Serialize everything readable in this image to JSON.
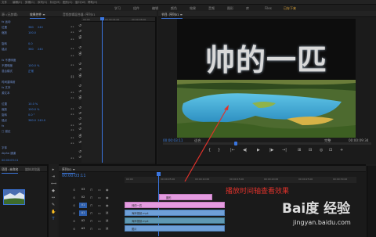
{
  "menubar": {
    "items": [
      "文件",
      "编辑(E)",
      "剪辑(C)",
      "序列(S)",
      "标记(M)",
      "图形(G)",
      "窗口(W)",
      "帮助(H)"
    ]
  },
  "workspace": {
    "items": [
      "学习",
      "组件",
      "编辑",
      "颜色",
      "效果",
      "音频",
      "图形",
      "库",
      "Files",
      "已存下来"
    ]
  },
  "effect_panel": {
    "tabs": [
      "源: (无剪辑)",
      "效果控件 ≡",
      "音频剪辑混合器: 序列01"
    ],
    "rows": [
      {
        "label": "fx 运动",
        "v": "",
        "v2": ""
      },
      {
        "label": "位置",
        "v": "360",
        "v2": "240"
      },
      {
        "label": "缩放",
        "v": "100.0",
        "v2": ""
      },
      {
        "label": "",
        "v": "",
        "v2": ""
      },
      {
        "label": "旋转",
        "v": "0.0",
        "v2": ""
      },
      {
        "label": "锚点",
        "v": "360",
        "v2": "240"
      },
      {
        "label": "",
        "v": "",
        "v2": ""
      },
      {
        "label": "fx 不透明度",
        "v": "",
        "v2": ""
      },
      {
        "label": "不透明度",
        "v": "100.0 %",
        "v2": ""
      },
      {
        "label": "混合模式",
        "v": "正常",
        "v2": ""
      },
      {
        "label": "",
        "v": "",
        "v2": ""
      },
      {
        "label": "时间重映射",
        "v": "",
        "v2": ""
      },
      {
        "label": "fx 文本",
        "v": "",
        "v2": ""
      },
      {
        "label": "源文本",
        "v": "",
        "v2": ""
      },
      {
        "label": "",
        "v": "",
        "v2": ""
      },
      {
        "label": "位置",
        "v": "10.0 %",
        "v2": ""
      },
      {
        "label": "缩放",
        "v": "100.0 %",
        "v2": ""
      },
      {
        "label": "旋转",
        "v": "0.0 °",
        "v2": ""
      },
      {
        "label": "锚点",
        "v": "360.0",
        "v2": "240.0"
      },
      {
        "label": "fx",
        "v": "",
        "v2": ""
      },
      {
        "label": "□ 描边",
        "v": "",
        "v2": ""
      },
      {
        "label": "",
        "v": "",
        "v2": ""
      },
      {
        "label": "",
        "v": "",
        "v2": ""
      },
      {
        "label": "字体",
        "v": "",
        "v2": ""
      },
      {
        "label": "Alpha 通道",
        "v": "",
        "v2": ""
      }
    ],
    "ruler_ticks": [
      "00:00",
      "00:00:04:00",
      "00:00:08:00"
    ],
    "bottom_timecode": "00:00:03:11"
  },
  "program": {
    "tab_label": "节目: 序列01 ≡",
    "title_text": "帅的一匹",
    "current_timecode": "00:00:03:11",
    "fit_label": "适合",
    "quality_label": "完整",
    "duration_timecode": "00:00:09:34",
    "transport_buttons": [
      "{",
      "}",
      "|←",
      "◀|",
      "▶",
      "|▶",
      "→|",
      "⊞",
      "⊟",
      "◎",
      "⊡",
      "+"
    ]
  },
  "project": {
    "tabs": [
      "项目: 未命名",
      "媒体浏览器"
    ]
  },
  "timeline": {
    "tab_label": "序列01 ≡",
    "timecode": "00:00:03:11",
    "ruler_ticks": [
      "00:00",
      "00:00:05:00",
      "00:00:10:00",
      "00:00:15:00",
      "00:00:20:00",
      "00:00:25:00",
      "00:00:30:00"
    ],
    "tracks": [
      "V3",
      "V2",
      "V1",
      "A1",
      "A2",
      "A3"
    ],
    "clips": {
      "v3": "图形",
      "v2": "帅的一匹",
      "v1a": "海岸视频.mp4",
      "a1": "海岸视频.mp4",
      "v1b": "图片"
    }
  },
  "annotation": "播放时间轴查看效果",
  "watermark": {
    "brand": "Bai度 经验",
    "site": "jingyan.baidu.com"
  },
  "colors": {
    "accent_blue": "#3b74d8",
    "workspace_active": "#e3a93b",
    "annotation_red": "#e0322b",
    "clip_pink": "#e49be0",
    "clip_blue": "#6fa0d8"
  }
}
